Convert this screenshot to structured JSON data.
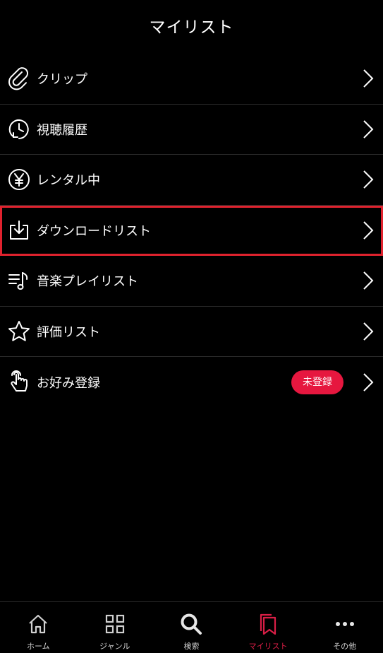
{
  "header": {
    "title": "マイリスト"
  },
  "menu": {
    "items": [
      {
        "label": "クリップ",
        "icon": "paperclip-icon"
      },
      {
        "label": "視聴履歴",
        "icon": "history-clock-icon"
      },
      {
        "label": "レンタル中",
        "icon": "yen-circle-icon"
      },
      {
        "label": "ダウンロードリスト",
        "icon": "download-icon",
        "highlighted": true
      },
      {
        "label": "音楽プレイリスト",
        "icon": "music-playlist-icon"
      },
      {
        "label": "評価リスト",
        "icon": "star-icon"
      },
      {
        "label": "お好み登録",
        "icon": "tap-hand-icon",
        "badge": "未登録"
      }
    ]
  },
  "tabbar": {
    "tabs": [
      {
        "label": "ホーム",
        "icon": "home-icon"
      },
      {
        "label": "ジャンル",
        "icon": "grid-icon"
      },
      {
        "label": "検索",
        "icon": "search-icon"
      },
      {
        "label": "マイリスト",
        "icon": "mylist-icon",
        "active": true
      },
      {
        "label": "その他",
        "icon": "more-dots-icon"
      }
    ]
  },
  "colors": {
    "background": "#000000",
    "highlight_border": "#e0222e",
    "badge": "#e6173f",
    "active_tab": "#d91e46",
    "divider": "#2a2a2a"
  }
}
